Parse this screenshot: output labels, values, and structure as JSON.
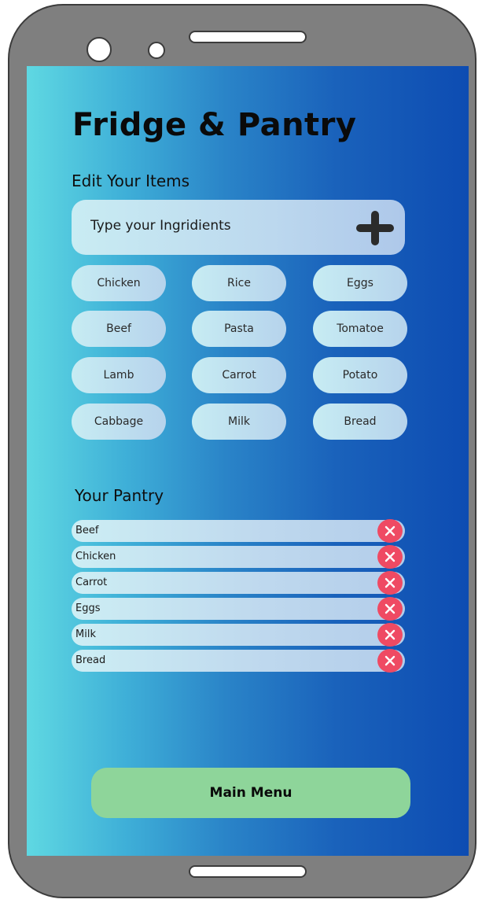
{
  "app": {
    "title": "Fridge & Pantry",
    "edit_heading": "Edit Your Items"
  },
  "add_item": {
    "placeholder": "Type your Ingridients",
    "add_icon": "plus-icon"
  },
  "ingredients": [
    "Chicken",
    "Rice",
    "Eggs",
    "Beef",
    "Pasta",
    "Tomatoe",
    "Lamb",
    "Carrot",
    "Potato",
    "Cabbage",
    "Milk",
    "Bread"
  ],
  "pantry": {
    "heading": "Your Pantry",
    "remove_icon": "close-icon",
    "items": [
      "Beef",
      "Chicken",
      "Carrot",
      "Eggs",
      "Milk",
      "Bread"
    ]
  },
  "footer": {
    "main_menu_label": "Main Menu"
  },
  "colors": {
    "gradient_start": "#5fd8e2",
    "gradient_end": "#0d4cb2",
    "remove_button": "#ef4a63",
    "main_menu_button": "#8ed59a"
  }
}
